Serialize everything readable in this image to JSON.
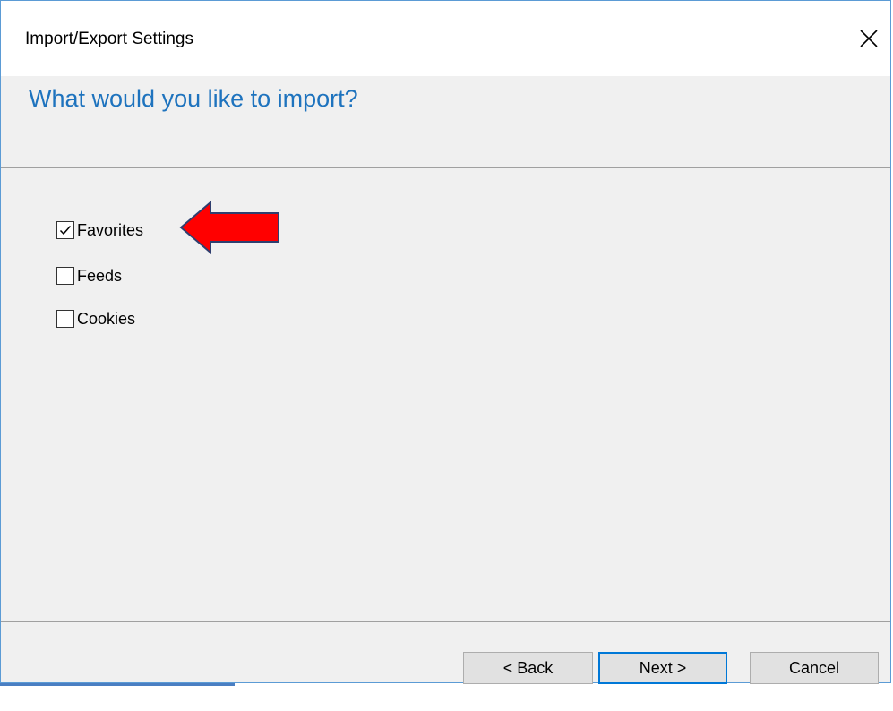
{
  "window": {
    "title": "Import/Export Settings",
    "close_icon": "close-icon"
  },
  "header": {
    "title": "What would you like to import?"
  },
  "options": [
    {
      "label": "Favorites",
      "checked": true
    },
    {
      "label": "Feeds",
      "checked": false
    },
    {
      "label": "Cookies",
      "checked": false
    }
  ],
  "annotation": {
    "arrow_color": "#ff0000",
    "arrow_icon": "red-arrow-left-icon"
  },
  "buttons": {
    "back": "< Back",
    "next": "Next >",
    "cancel": "Cancel"
  },
  "colors": {
    "accent": "#1e73be",
    "window_border": "#5b9bd5",
    "default_button_border": "#0078d7"
  }
}
